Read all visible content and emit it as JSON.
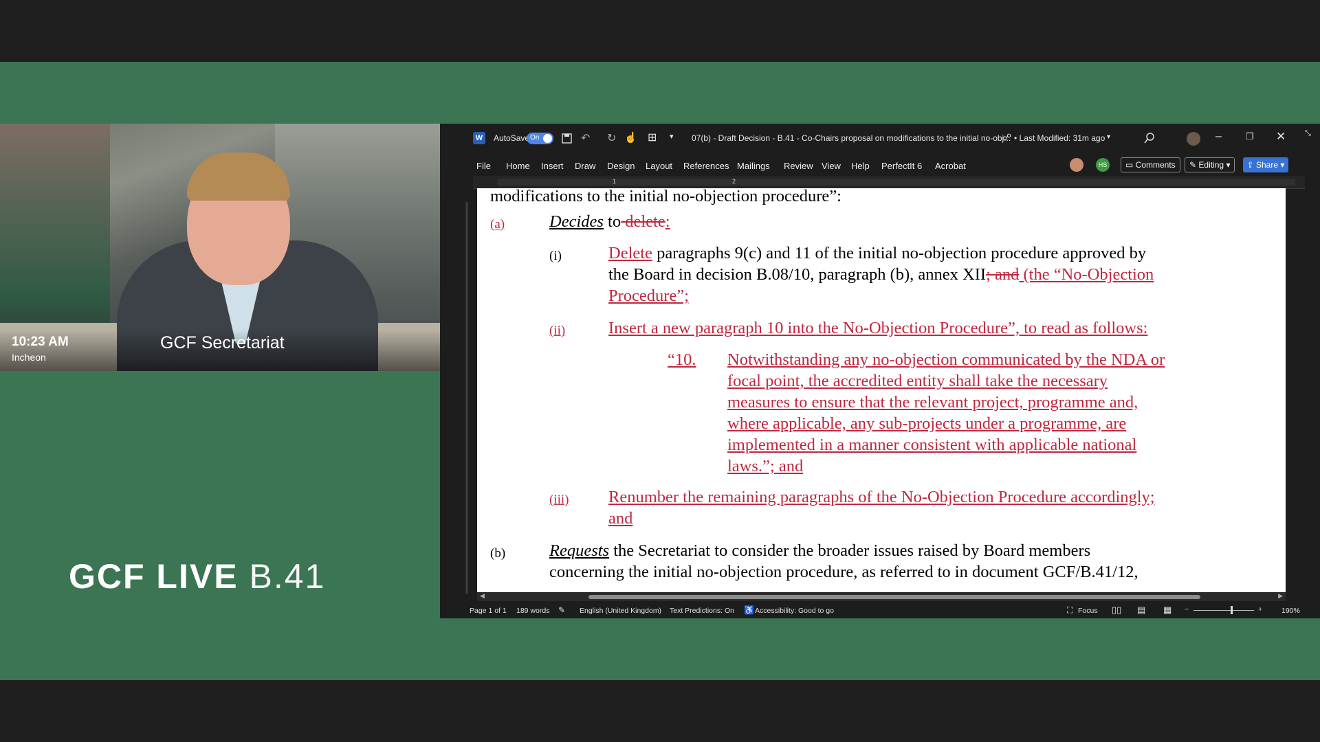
{
  "camera": {
    "time": "10:23 AM",
    "location": "Incheon",
    "speaker": "GCF Secretariat"
  },
  "brand": {
    "bold": "GCF LIVE",
    "light": "B.41"
  },
  "word": {
    "titlebar": {
      "autosave_label": "AutoSave",
      "autosave_state": "On",
      "doc_title": "07(b) - Draft Decision - B.41 - Co-Chairs proposal on modifications to the initial no-obj...",
      "last_modified": "• Last Modified: 31m ago"
    },
    "menu": [
      "File",
      "Home",
      "Insert",
      "Draw",
      "Design",
      "Layout",
      "References",
      "Mailings",
      "Review",
      "View",
      "Help",
      "PerfectIt 6",
      "Acrobat"
    ],
    "collab_initials": "HS",
    "buttons": {
      "comments": "Comments",
      "editing": "Editing",
      "share": "Share"
    },
    "ruler_numbers": [
      "1",
      "2"
    ],
    "document": {
      "l1": "modifications to the initial no-objection procedure”:",
      "a_label": "(a)",
      "a_decides": "Decides",
      "a_to": " to",
      "a_delete_struck": " delete",
      "a_colon": ":",
      "i_label": "(i)",
      "i_delete": "Delete",
      "i_text1": " paragraphs 9(c) and 11 of the initial no-objection procedure approved by",
      "i_text2": "the Board in decision B.08/10, paragraph (b), annex XII",
      "i_struck": "; and",
      "i_red": " (the “No-Objection",
      "i_text3": "Procedure”;",
      "ii_label": "(ii)",
      "ii_text": "Insert a new paragraph 10 into the No-Objection Procedure”, to read as follows:",
      "q_num": "“10.",
      "q1": "Notwithstanding any no-objection communicated by the NDA or",
      "q2": "focal point, the accredited entity shall take the necessary",
      "q3": "measures to ensure that the relevant project, programme and,",
      "q4": "where applicable, any sub-projects under a programme, are",
      "q5": "implemented in a manner consistent with applicable national",
      "q6": "laws.”; and",
      "iii_label": "(iii)",
      "iii_text1": "Renumber the remaining paragraphs of the No-Objection Procedure accordingly;",
      "iii_text2": "and",
      "b_label": "(b)",
      "b_requests": "Requests",
      "b_text1": " the Secretariat to consider the broader issues raised by Board members",
      "b_text2": "concerning the initial no-objection procedure, as referred to in document GCF/B.41/12,"
    },
    "status": {
      "page": "Page 1 of 1",
      "words": "189 words",
      "language": "English (United Kingdom)",
      "predictions": "Text Predictions: On",
      "accessibility": "Accessibility: Good to go",
      "focus": "Focus",
      "zoom_minus": "−",
      "zoom_plus": "+",
      "zoom": "190%"
    }
  },
  "colors": {
    "stage_green": "#3c7553",
    "revision_red": "#c0273f",
    "share_blue": "#3872d4"
  }
}
